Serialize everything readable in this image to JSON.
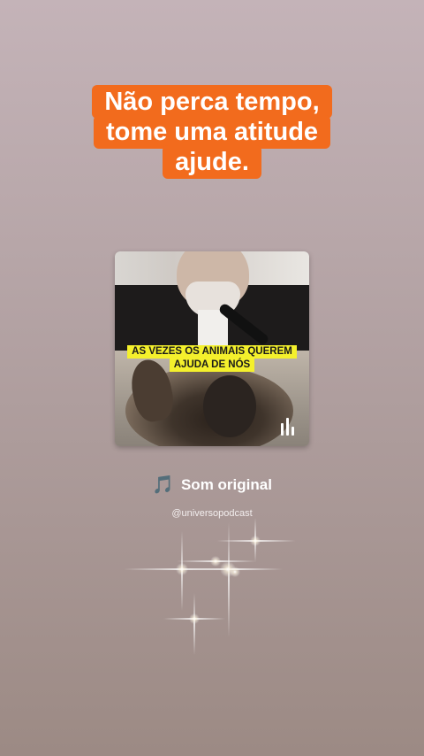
{
  "headline": {
    "lines": [
      "Não perca tempo,",
      "tome uma atitude",
      "ajude."
    ],
    "background_color": "#f26b1d"
  },
  "cover": {
    "caption_lines": [
      "AS VEZES OS ANIMAIS QUEREM",
      "AJUDA DE NÓS"
    ],
    "caption_color": "#f4f02c",
    "bars_icon": "audio-bars-icon"
  },
  "sound": {
    "icon": "music-note-icon",
    "glyph": "🎵",
    "title": "Som original",
    "handle": "@universopodcast"
  }
}
